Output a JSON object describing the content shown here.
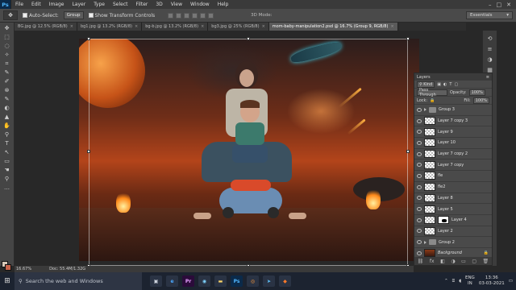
{
  "app": {
    "logo": "Ps"
  },
  "menu": [
    "File",
    "Edit",
    "Image",
    "Layer",
    "Type",
    "Select",
    "Filter",
    "3D",
    "View",
    "Window",
    "Help"
  ],
  "window_controls": [
    "–",
    "□",
    "✕"
  ],
  "options": {
    "tool_glyph": "✥",
    "auto_select_label": "Auto-Select:",
    "auto_select_value": "Group",
    "show_transform_label": "Show Transform Controls",
    "mode_3d_label": "3D Mode:",
    "workspace": "Essentials"
  },
  "tabs": [
    {
      "label": "BG.jpg @ 12.5% (RGB/8)",
      "active": false
    },
    {
      "label": "bg1.jpg @ 13.2% (RGB/8)",
      "active": false
    },
    {
      "label": "bg-b.jpg @ 13.2% (RGB/8)",
      "active": false
    },
    {
      "label": "bg3.jpg @ 25% (RGB/8)",
      "active": false
    },
    {
      "label": "mom-baby-manipulation2.psd @ 16.7% (Group 9, RGB/8)",
      "active": true
    }
  ],
  "tools": [
    "✥",
    "⬚",
    "◌",
    "✧",
    "⌗",
    "✎",
    "✐",
    "⊗",
    "✎",
    "◐",
    "▲",
    "✋",
    "⚲",
    "T",
    "↖",
    "▭",
    "☚",
    "⚲",
    "…"
  ],
  "statusbar": {
    "zoom": "16.67%",
    "doc": "Doc: 55.4M/1.32G"
  },
  "layers_panel": {
    "title": "Layers",
    "kind_label": "Kind",
    "blend_mode": "Pass Through",
    "opacity_label": "Opacity:",
    "opacity": "100%",
    "lock_label": "Lock:",
    "fill_label": "Fill:",
    "fill": "100%",
    "layers": [
      {
        "name": "Group 3",
        "type": "group"
      },
      {
        "name": "Layer 7 copy 3",
        "type": "layer"
      },
      {
        "name": "Layer 9",
        "type": "layer"
      },
      {
        "name": "Layer 10",
        "type": "layer"
      },
      {
        "name": "Layer 7 copy 2",
        "type": "layer"
      },
      {
        "name": "Layer 7 copy",
        "type": "layer"
      },
      {
        "name": "fle",
        "type": "layer"
      },
      {
        "name": "fle2",
        "type": "layer"
      },
      {
        "name": "Layer 8",
        "type": "layer"
      },
      {
        "name": "Layer 5",
        "type": "layer"
      },
      {
        "name": "Layer 4",
        "type": "mask"
      },
      {
        "name": "Layer 2",
        "type": "layer"
      },
      {
        "name": "Group 2",
        "type": "group"
      },
      {
        "name": "Background",
        "type": "bg"
      }
    ],
    "footer_icons": [
      "⛓",
      "fx",
      "◧",
      "◑",
      "▭",
      "▢",
      "🗑"
    ]
  },
  "taskbar": {
    "search_placeholder": "Search the web and Windows",
    "apps": [
      {
        "label": "▣",
        "color": "#cfd6e0",
        "bg": "#2a3344"
      },
      {
        "label": "e",
        "color": "#4aa8ff",
        "bg": "#2a3344"
      },
      {
        "label": "Pr",
        "color": "#e6a0ff",
        "bg": "#2b0b3a"
      },
      {
        "label": "◉",
        "color": "#7fd3ff",
        "bg": "#2a3344"
      },
      {
        "label": "▬",
        "color": "#ffd86a",
        "bg": "#2a3344"
      },
      {
        "label": "Ps",
        "color": "#4fb6ff",
        "bg": "#0b2a4a"
      },
      {
        "label": "◎",
        "color": "#ff9a3a",
        "bg": "#2a3344"
      },
      {
        "label": "➤",
        "color": "#5fc6ff",
        "bg": "#2a3344"
      },
      {
        "label": "◆",
        "color": "#ff7a2a",
        "bg": "#2a3344"
      }
    ],
    "lang": "ENG",
    "region": "IN",
    "time": "13:36",
    "date": "03-03-2021"
  }
}
